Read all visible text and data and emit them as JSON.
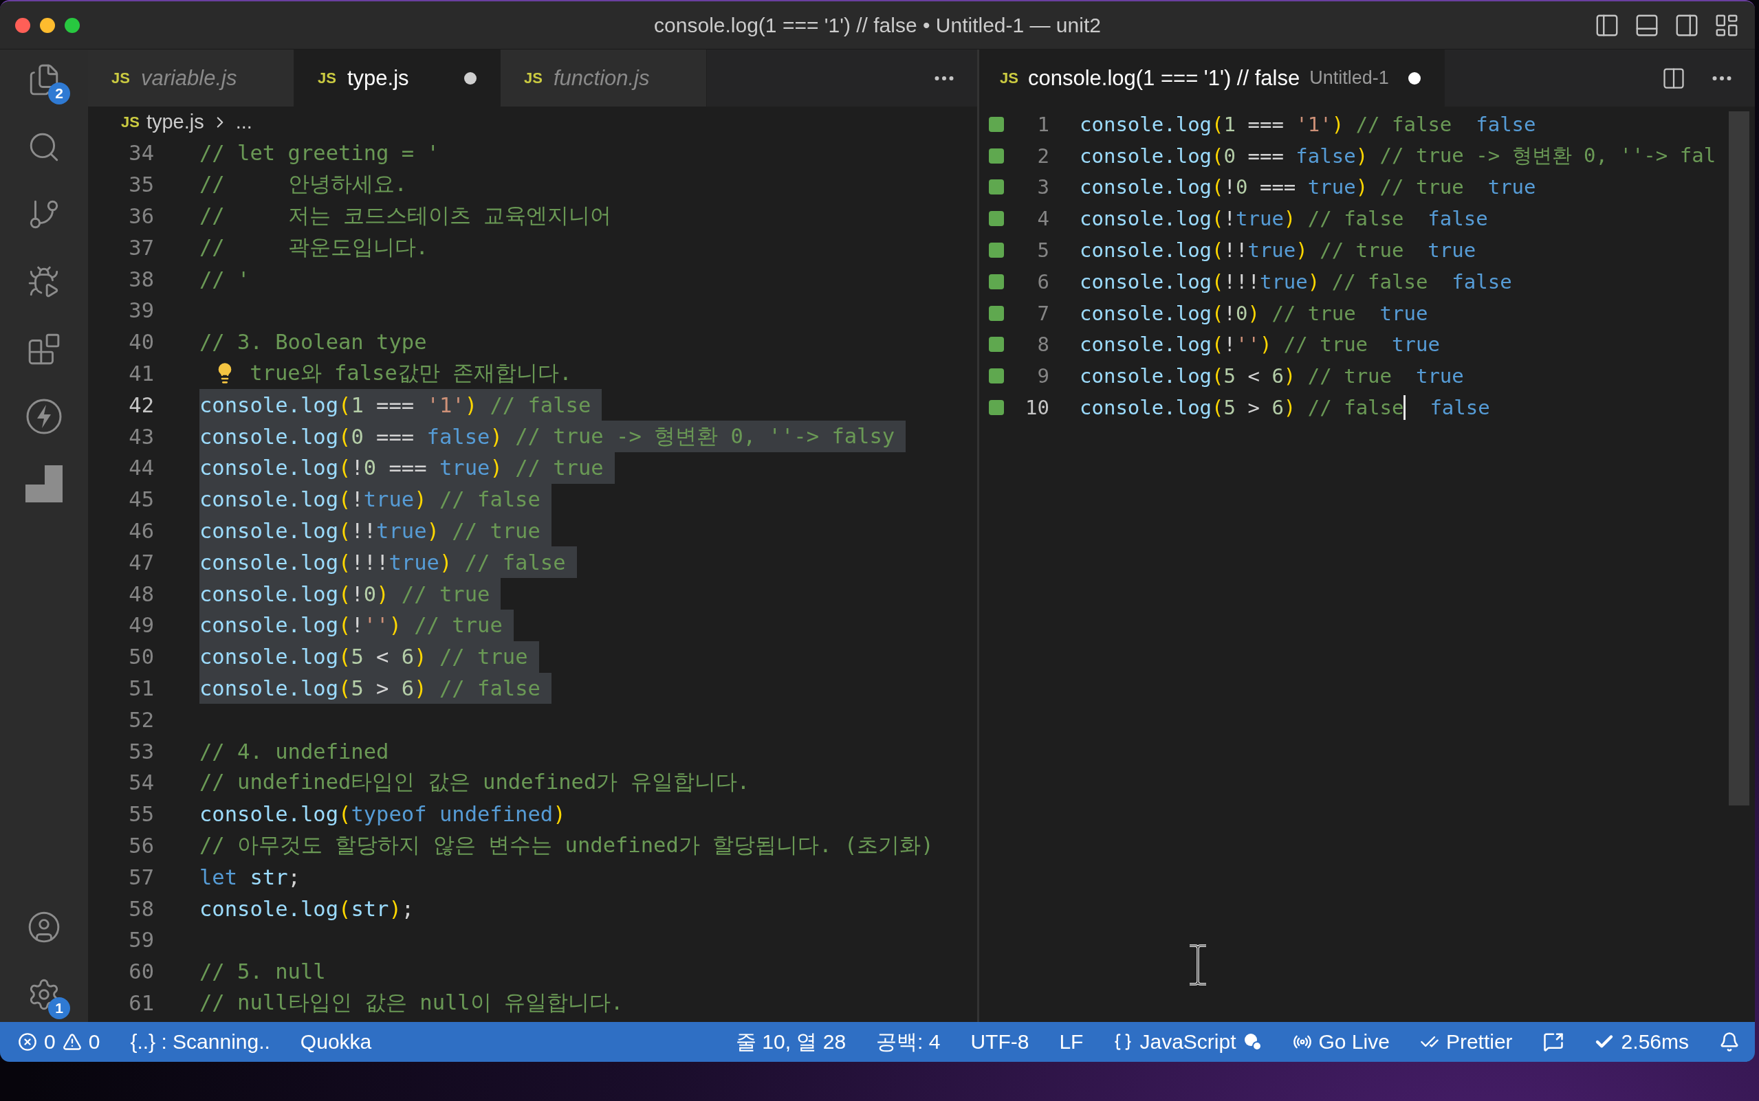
{
  "window": {
    "title": "console.log(1 === '1') // false • Untitled-1 — unit2"
  },
  "activity_bar": {
    "top": [
      {
        "kind": "explorer",
        "badge": "2"
      },
      {
        "kind": "search"
      },
      {
        "kind": "source_control"
      },
      {
        "kind": "run_debug"
      },
      {
        "kind": "extensions"
      },
      {
        "kind": "lightning"
      },
      {
        "kind": "block"
      }
    ],
    "bottom": [
      {
        "kind": "account"
      },
      {
        "kind": "settings",
        "badge": "1"
      }
    ]
  },
  "left_editor": {
    "tabs": [
      {
        "badge": "JS",
        "label": "variable.js",
        "selected": false,
        "preview": true,
        "dirty": false
      },
      {
        "badge": "JS",
        "label": "type.js",
        "selected": true,
        "preview": false,
        "dirty": true
      },
      {
        "badge": "JS",
        "label": "function.js",
        "selected": false,
        "preview": true,
        "dirty": false
      }
    ],
    "breadcrumb": {
      "badge": "JS",
      "file": "type.js",
      "rest": "..."
    },
    "lines": [
      {
        "number": "34",
        "active": false,
        "highlighted": false,
        "tokens": [
          {
            "kind": "comment",
            "text": "// let greeting = '"
          }
        ]
      },
      {
        "number": "35",
        "active": false,
        "highlighted": false,
        "tokens": [
          {
            "kind": "comment",
            "text": "//     안녕하세요."
          }
        ]
      },
      {
        "number": "36",
        "active": false,
        "highlighted": false,
        "tokens": [
          {
            "kind": "comment",
            "text": "//     저는 코드스테이츠 교육엔지니어"
          }
        ]
      },
      {
        "number": "37",
        "active": false,
        "highlighted": false,
        "tokens": [
          {
            "kind": "comment",
            "text": "//     곽운도입니다."
          }
        ]
      },
      {
        "number": "38",
        "active": false,
        "highlighted": false,
        "tokens": [
          {
            "kind": "comment",
            "text": "// '"
          }
        ]
      },
      {
        "number": "39",
        "active": false,
        "highlighted": false
      },
      {
        "number": "40",
        "active": false,
        "highlighted": false,
        "tokens": [
          {
            "kind": "comment",
            "text": "// 3. Boolean type"
          }
        ]
      },
      {
        "number": "41",
        "active": false,
        "highlighted": false,
        "lightbulb": true,
        "tokens": [
          {
            "kind": "comment",
            "text": "true와 false값만 존재합니다."
          }
        ]
      },
      {
        "number": "42",
        "active": true,
        "highlighted": true,
        "tokens": [
          {
            "kind": "call",
            "text": "console.log"
          },
          {
            "kind": "paren",
            "text": "("
          },
          {
            "kind": "num",
            "text": "1"
          },
          {
            "kind": "op",
            "text": " === "
          },
          {
            "kind": "str",
            "text": "'1'"
          },
          {
            "kind": "paren",
            "text": ")"
          },
          {
            "kind": "comment",
            "text": " // false"
          }
        ]
      },
      {
        "number": "43",
        "active": false,
        "highlighted": true,
        "tokens": [
          {
            "kind": "call",
            "text": "console.log"
          },
          {
            "kind": "paren",
            "text": "("
          },
          {
            "kind": "num",
            "text": "0"
          },
          {
            "kind": "op",
            "text": " === "
          },
          {
            "kind": "keyword",
            "text": "false"
          },
          {
            "kind": "paren",
            "text": ")"
          },
          {
            "kind": "comment",
            "text": " // true -> 형변환 0, ''-> falsy"
          }
        ]
      },
      {
        "number": "44",
        "active": false,
        "highlighted": true,
        "tokens": [
          {
            "kind": "call",
            "text": "console.log"
          },
          {
            "kind": "paren",
            "text": "("
          },
          {
            "kind": "op",
            "text": "!"
          },
          {
            "kind": "num",
            "text": "0"
          },
          {
            "kind": "op",
            "text": " === "
          },
          {
            "kind": "keyword",
            "text": "true"
          },
          {
            "kind": "paren",
            "text": ")"
          },
          {
            "kind": "comment",
            "text": " // true"
          }
        ]
      },
      {
        "number": "45",
        "active": false,
        "highlighted": true,
        "tokens": [
          {
            "kind": "call",
            "text": "console.log"
          },
          {
            "kind": "paren",
            "text": "("
          },
          {
            "kind": "op",
            "text": "!"
          },
          {
            "kind": "keyword",
            "text": "true"
          },
          {
            "kind": "paren",
            "text": ")"
          },
          {
            "kind": "comment",
            "text": " // false"
          }
        ]
      },
      {
        "number": "46",
        "active": false,
        "highlighted": true,
        "tokens": [
          {
            "kind": "call",
            "text": "console.log"
          },
          {
            "kind": "paren",
            "text": "("
          },
          {
            "kind": "op",
            "text": "!!"
          },
          {
            "kind": "keyword",
            "text": "true"
          },
          {
            "kind": "paren",
            "text": ")"
          },
          {
            "kind": "comment",
            "text": " // true"
          }
        ]
      },
      {
        "number": "47",
        "active": false,
        "highlighted": true,
        "tokens": [
          {
            "kind": "call",
            "text": "console.log"
          },
          {
            "kind": "paren",
            "text": "("
          },
          {
            "kind": "op",
            "text": "!!!"
          },
          {
            "kind": "keyword",
            "text": "true"
          },
          {
            "kind": "paren",
            "text": ")"
          },
          {
            "kind": "comment",
            "text": " // false"
          }
        ]
      },
      {
        "number": "48",
        "active": false,
        "highlighted": true,
        "tokens": [
          {
            "kind": "call",
            "text": "console.log"
          },
          {
            "kind": "paren",
            "text": "("
          },
          {
            "kind": "op",
            "text": "!"
          },
          {
            "kind": "num",
            "text": "0"
          },
          {
            "kind": "paren",
            "text": ")"
          },
          {
            "kind": "comment",
            "text": " // true"
          }
        ]
      },
      {
        "number": "49",
        "active": false,
        "highlighted": true,
        "tokens": [
          {
            "kind": "call",
            "text": "console.log"
          },
          {
            "kind": "paren",
            "text": "("
          },
          {
            "kind": "op",
            "text": "!"
          },
          {
            "kind": "str",
            "text": "''"
          },
          {
            "kind": "paren",
            "text": ")"
          },
          {
            "kind": "comment",
            "text": " // true"
          }
        ]
      },
      {
        "number": "50",
        "active": false,
        "highlighted": true,
        "tokens": [
          {
            "kind": "call",
            "text": "console.log"
          },
          {
            "kind": "paren",
            "text": "("
          },
          {
            "kind": "num",
            "text": "5"
          },
          {
            "kind": "op",
            "text": " < "
          },
          {
            "kind": "num",
            "text": "6"
          },
          {
            "kind": "paren",
            "text": ")"
          },
          {
            "kind": "comment",
            "text": " // true"
          }
        ]
      },
      {
        "number": "51",
        "active": false,
        "highlighted": true,
        "tokens": [
          {
            "kind": "call",
            "text": "console.log"
          },
          {
            "kind": "paren",
            "text": "("
          },
          {
            "kind": "num",
            "text": "5"
          },
          {
            "kind": "op",
            "text": " > "
          },
          {
            "kind": "num",
            "text": "6"
          },
          {
            "kind": "paren",
            "text": ")"
          },
          {
            "kind": "comment",
            "text": " // false"
          }
        ]
      },
      {
        "number": "52",
        "active": false,
        "highlighted": false
      },
      {
        "number": "53",
        "active": false,
        "highlighted": false,
        "tokens": [
          {
            "kind": "comment",
            "text": "// 4. undefined"
          }
        ]
      },
      {
        "number": "54",
        "active": false,
        "highlighted": false,
        "tokens": [
          {
            "kind": "comment",
            "text": "// undefined타입인 값은 undefined가 유일합니다."
          }
        ]
      },
      {
        "number": "55",
        "active": false,
        "highlighted": false,
        "tokens": [
          {
            "kind": "call",
            "text": "console.log"
          },
          {
            "kind": "paren",
            "text": "("
          },
          {
            "kind": "keyword",
            "text": "typeof undefined"
          },
          {
            "kind": "paren",
            "text": ")"
          }
        ]
      },
      {
        "number": "56",
        "active": false,
        "highlighted": false,
        "tokens": [
          {
            "kind": "comment",
            "text": "// 아무것도 할당하지 않은 변수는 undefined가 할당됩니다. (초기화)"
          }
        ]
      },
      {
        "number": "57",
        "active": false,
        "highlighted": false,
        "tokens": [
          {
            "kind": "keyword",
            "text": "let"
          },
          {
            "kind": "var",
            "text": " str"
          },
          {
            "kind": "op",
            "text": ";"
          }
        ]
      },
      {
        "number": "58",
        "active": false,
        "highlighted": false,
        "tokens": [
          {
            "kind": "call",
            "text": "console.log"
          },
          {
            "kind": "paren",
            "text": "("
          },
          {
            "kind": "var",
            "text": "str"
          },
          {
            "kind": "paren",
            "text": ")"
          },
          {
            "kind": "op",
            "text": ";"
          }
        ]
      },
      {
        "number": "59",
        "active": false,
        "highlighted": false
      },
      {
        "number": "60",
        "active": false,
        "highlighted": false,
        "tokens": [
          {
            "kind": "comment",
            "text": "// 5. null"
          }
        ]
      },
      {
        "number": "61",
        "active": false,
        "highlighted": false,
        "tokens": [
          {
            "kind": "comment",
            "text": "// null타입인 값은 null이 유일합니다."
          }
        ]
      }
    ]
  },
  "right_editor": {
    "tab": {
      "badge": "JS",
      "label": "console.log(1 === '1') // false",
      "description": "Untitled-1",
      "selected": true,
      "dirty": true
    },
    "lines": [
      {
        "number": "1",
        "covered": true,
        "active": false,
        "cursor": false,
        "tokens": [
          {
            "kind": "call",
            "text": "console.log"
          },
          {
            "kind": "paren",
            "text": "("
          },
          {
            "kind": "num",
            "text": "1"
          },
          {
            "kind": "op",
            "text": " === "
          },
          {
            "kind": "str",
            "text": "'1'"
          },
          {
            "kind": "paren",
            "text": ")"
          },
          {
            "kind": "comment",
            "text": " // false"
          }
        ],
        "result": "false"
      },
      {
        "number": "2",
        "covered": true,
        "active": false,
        "cursor": false,
        "tokens": [
          {
            "kind": "call",
            "text": "console.log"
          },
          {
            "kind": "paren",
            "text": "("
          },
          {
            "kind": "num",
            "text": "0"
          },
          {
            "kind": "op",
            "text": " === "
          },
          {
            "kind": "keyword",
            "text": "false"
          },
          {
            "kind": "paren",
            "text": ")"
          },
          {
            "kind": "comment",
            "text": " // true -> 형변환 0, ''-> fal"
          }
        ]
      },
      {
        "number": "3",
        "covered": true,
        "active": false,
        "cursor": false,
        "tokens": [
          {
            "kind": "call",
            "text": "console.log"
          },
          {
            "kind": "paren",
            "text": "("
          },
          {
            "kind": "op",
            "text": "!"
          },
          {
            "kind": "num",
            "text": "0"
          },
          {
            "kind": "op",
            "text": " === "
          },
          {
            "kind": "keyword",
            "text": "true"
          },
          {
            "kind": "paren",
            "text": ")"
          },
          {
            "kind": "comment",
            "text": " // true"
          }
        ],
        "result": "true"
      },
      {
        "number": "4",
        "covered": true,
        "active": false,
        "cursor": false,
        "tokens": [
          {
            "kind": "call",
            "text": "console.log"
          },
          {
            "kind": "paren",
            "text": "("
          },
          {
            "kind": "op",
            "text": "!"
          },
          {
            "kind": "keyword",
            "text": "true"
          },
          {
            "kind": "paren",
            "text": ")"
          },
          {
            "kind": "comment",
            "text": " // false"
          }
        ],
        "result": "false"
      },
      {
        "number": "5",
        "covered": true,
        "active": false,
        "cursor": false,
        "tokens": [
          {
            "kind": "call",
            "text": "console.log"
          },
          {
            "kind": "paren",
            "text": "("
          },
          {
            "kind": "op",
            "text": "!!"
          },
          {
            "kind": "keyword",
            "text": "true"
          },
          {
            "kind": "paren",
            "text": ")"
          },
          {
            "kind": "comment",
            "text": " // true"
          }
        ],
        "result": "true"
      },
      {
        "number": "6",
        "covered": true,
        "active": false,
        "cursor": false,
        "tokens": [
          {
            "kind": "call",
            "text": "console.log"
          },
          {
            "kind": "paren",
            "text": "("
          },
          {
            "kind": "op",
            "text": "!!!"
          },
          {
            "kind": "keyword",
            "text": "true"
          },
          {
            "kind": "paren",
            "text": ")"
          },
          {
            "kind": "comment",
            "text": " // false"
          }
        ],
        "result": "false"
      },
      {
        "number": "7",
        "covered": true,
        "active": false,
        "cursor": false,
        "tokens": [
          {
            "kind": "call",
            "text": "console.log"
          },
          {
            "kind": "paren",
            "text": "("
          },
          {
            "kind": "op",
            "text": "!"
          },
          {
            "kind": "num",
            "text": "0"
          },
          {
            "kind": "paren",
            "text": ")"
          },
          {
            "kind": "comment",
            "text": " // true"
          }
        ],
        "result": "true"
      },
      {
        "number": "8",
        "covered": true,
        "active": false,
        "cursor": false,
        "tokens": [
          {
            "kind": "call",
            "text": "console.log"
          },
          {
            "kind": "paren",
            "text": "("
          },
          {
            "kind": "op",
            "text": "!"
          },
          {
            "kind": "str",
            "text": "''"
          },
          {
            "kind": "paren",
            "text": ")"
          },
          {
            "kind": "comment",
            "text": " // true"
          }
        ],
        "result": "true"
      },
      {
        "number": "9",
        "covered": true,
        "active": false,
        "cursor": false,
        "tokens": [
          {
            "kind": "call",
            "text": "console.log"
          },
          {
            "kind": "paren",
            "text": "("
          },
          {
            "kind": "num",
            "text": "5"
          },
          {
            "kind": "op",
            "text": " < "
          },
          {
            "kind": "num",
            "text": "6"
          },
          {
            "kind": "paren",
            "text": ")"
          },
          {
            "kind": "comment",
            "text": " // true"
          }
        ],
        "result": "true"
      },
      {
        "number": "10",
        "covered": true,
        "active": true,
        "cursor": true,
        "tokens": [
          {
            "kind": "call",
            "text": "console.log"
          },
          {
            "kind": "paren",
            "text": "("
          },
          {
            "kind": "num",
            "text": "5"
          },
          {
            "kind": "op",
            "text": " > "
          },
          {
            "kind": "num",
            "text": "6"
          },
          {
            "kind": "paren",
            "text": ")"
          },
          {
            "kind": "comment",
            "text": " // false"
          }
        ],
        "result": "false"
      }
    ]
  },
  "status_bar": {
    "left": [
      {
        "kind": "problems",
        "errors": "0",
        "warnings": "0"
      },
      {
        "kind": "text",
        "text": "{..} : Scanning.."
      },
      {
        "kind": "text",
        "text": "Quokka"
      }
    ],
    "right": [
      {
        "kind": "text",
        "text": "줄 10, 열 28"
      },
      {
        "kind": "text",
        "text": "공백: 4"
      },
      {
        "kind": "text",
        "text": "UTF-8"
      },
      {
        "kind": "text",
        "text": "LF"
      },
      {
        "kind": "language",
        "text": "JavaScript"
      },
      {
        "kind": "go_live",
        "text": "Go Live"
      },
      {
        "kind": "prettier",
        "text": "Prettier"
      },
      {
        "kind": "feedback"
      },
      {
        "kind": "timing",
        "text": "2.56ms"
      },
      {
        "kind": "notifications"
      }
    ]
  }
}
